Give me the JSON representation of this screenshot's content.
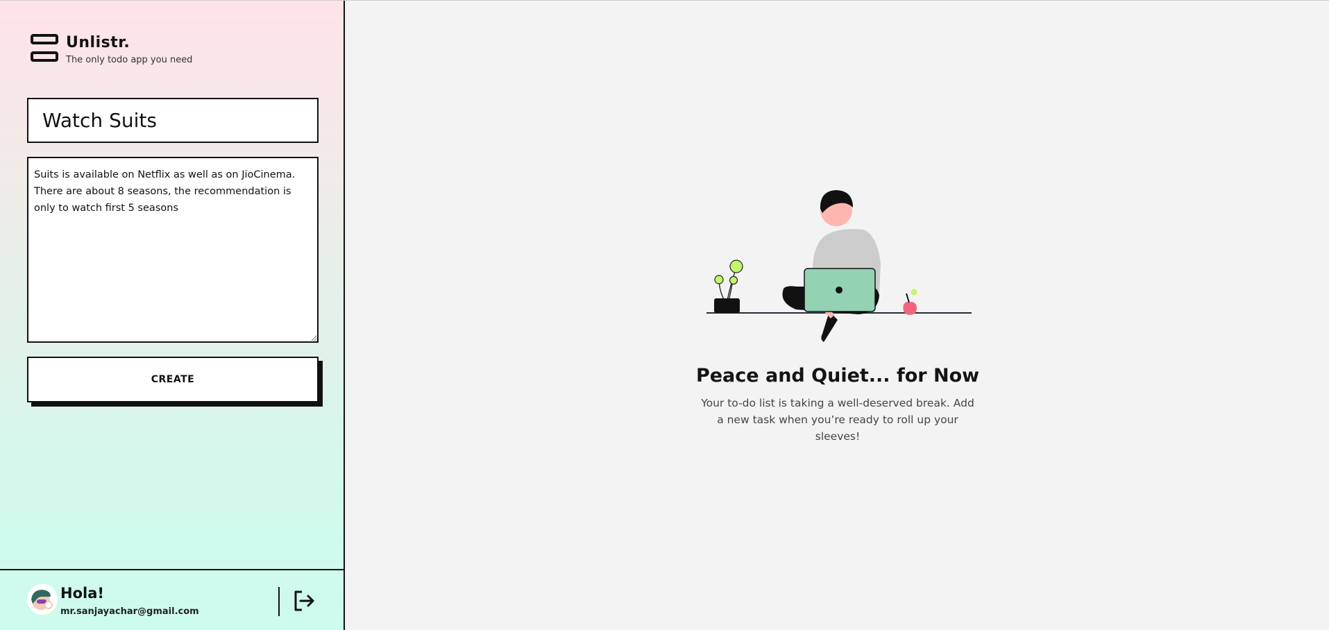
{
  "app": {
    "name": "Unlistr.",
    "tagline": "The only todo app you need"
  },
  "form": {
    "title_value": "Watch Suits",
    "description_value": "Suits is available on Netflix as well as on JioCinema. There are about 8 seasons, the recommendation is only to watch first 5 seasons",
    "create_label": "CREATE"
  },
  "user": {
    "greeting": "Hola!",
    "email": "mr.sanjayachar@gmail.com"
  },
  "empty_state": {
    "title": "Peace and Quiet... for Now",
    "message": "Your to-do list is taking a well-deserved break. Add a new task when you’re ready to roll up your sleeves!"
  },
  "icons": {
    "brand": "list-layout-icon",
    "logout": "logout-icon"
  },
  "colors": {
    "sidebar_top": "#ffe2e8",
    "sidebar_bottom": "#cdfbee",
    "laptop": "#8fd1b2",
    "plant": "#c3f56d",
    "apple": "#f2647e",
    "skin": "#ffb6b0"
  }
}
